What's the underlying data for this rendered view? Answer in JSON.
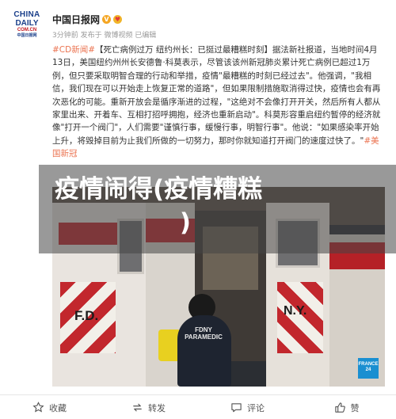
{
  "account": {
    "logo_line1": "CHINA",
    "logo_line2": "DAILY",
    "logo_line3": "COM.CN",
    "logo_line4": "中国日报网",
    "name": "中国日报网",
    "verified_badge": "V",
    "heart_badge": "♥",
    "meta": "3分钟前 发布于 微博视频  已编辑"
  },
  "post": {
    "tag_open": "#CD新闻#",
    "text": "【死亡病例过万 纽约州长：已挺过最糟糕时刻】据法新社报道，当地时间4月13日，美国纽约州州长安德鲁·科莫表示，尽管该该州新冠肺炎累计死亡病例已超过1万例，但只要采取明智合理的行动和举措，疫情\"最糟糕的时刻已经过去\"。他强调，\"我相信，我们现在可以开始走上恢复正常的道路\"，但如果限制措施取消得过快，疫情也会有再次恶化的可能。重新开放会是循序渐进的过程，\"这绝对不会像打开开关，然后所有人都从家里出来、开着车、互相打招呼拥抱，经济也重新启动\"。科莫形容重启纽约暂停的经济就像\"打开一个阀门\"，人们需要\"谨慎行事，缓慢行事，明智行事\"。他说：\"如果感染率开始上升，将毁掉目前为止我们所做的一切努力，那时你就知道打开阀门的速度过快了。\"",
    "tag_close": "#美国新冠"
  },
  "image": {
    "fd_label": "F.D.",
    "ny_label": "N.Y.",
    "medic_label_1": "FDNY",
    "medic_label_2": "PARAMEDIC",
    "source_line1": "FRANCE",
    "source_line2": "24"
  },
  "banner": {
    "title_line1": "疫情闹得(疫情糟糕",
    "title_line2": ")"
  },
  "actions": [
    {
      "label": "收藏",
      "icon": "star-icon"
    },
    {
      "label": "转发",
      "icon": "repost-icon"
    },
    {
      "label": "评论",
      "icon": "comment-icon"
    },
    {
      "label": "赞",
      "icon": "like-icon"
    }
  ]
}
